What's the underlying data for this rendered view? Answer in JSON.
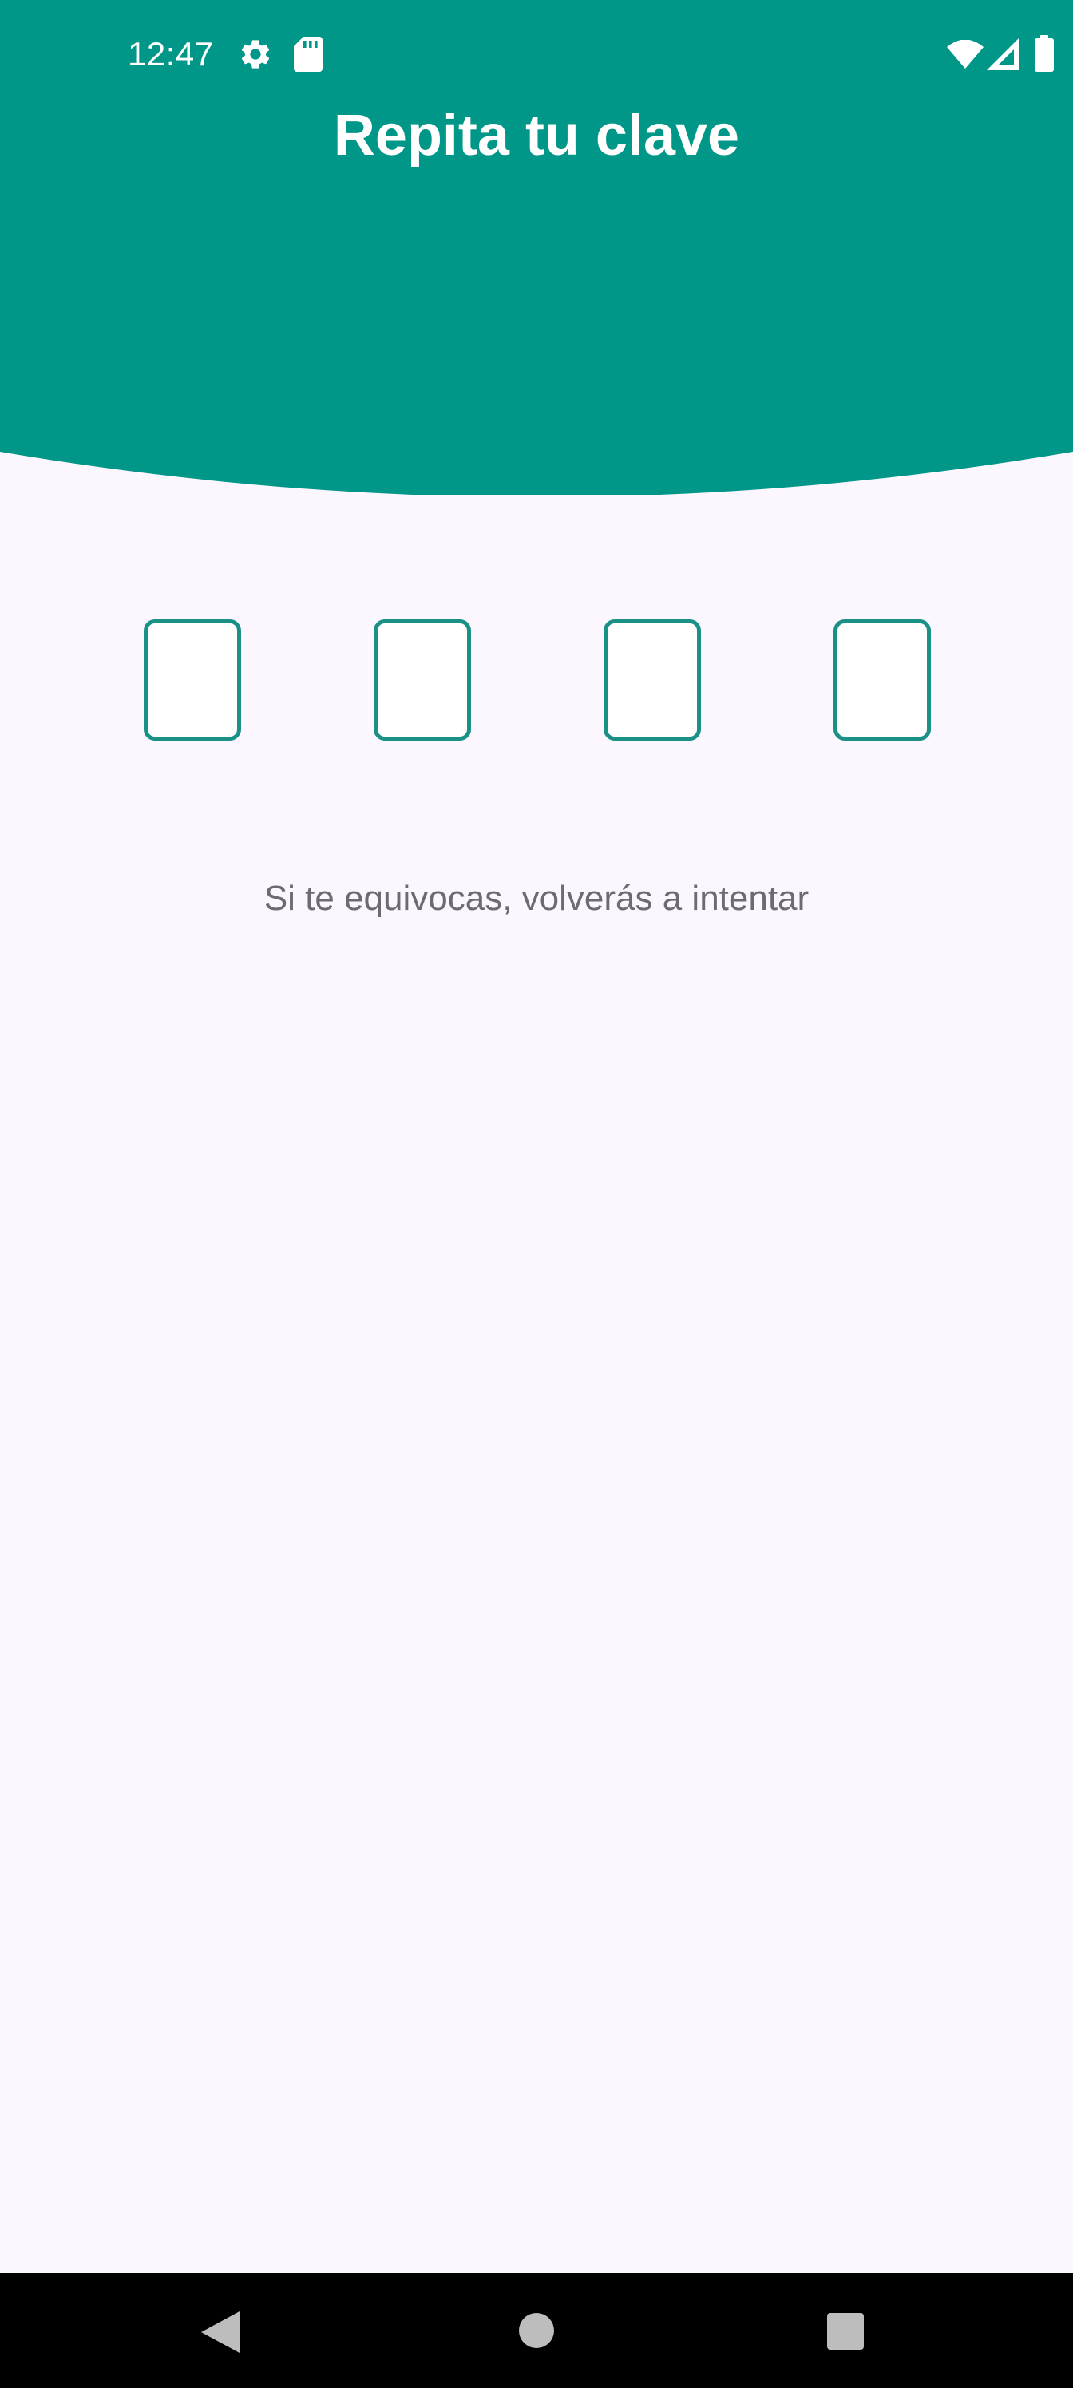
{
  "status_bar": {
    "time": "12:47",
    "icons": [
      "gear-icon",
      "sd-card-icon",
      "wifi-icon",
      "cell-signal-icon",
      "battery-icon"
    ]
  },
  "header": {
    "title": "Repita tu clave"
  },
  "pin": {
    "digit_count": 4,
    "values": [
      "",
      "",
      "",
      ""
    ]
  },
  "hint": "Si te equivocas, volverás a intentar",
  "nav_bar": {
    "buttons": [
      "back-button",
      "home-button",
      "recents-button"
    ]
  },
  "colors": {
    "header": "#009688",
    "background": "#FCF6FE",
    "pin_border": "#1A9186",
    "hint_text": "#6E6A72",
    "nav_bar": "#000000",
    "nav_icon": "#BDBDBD"
  }
}
